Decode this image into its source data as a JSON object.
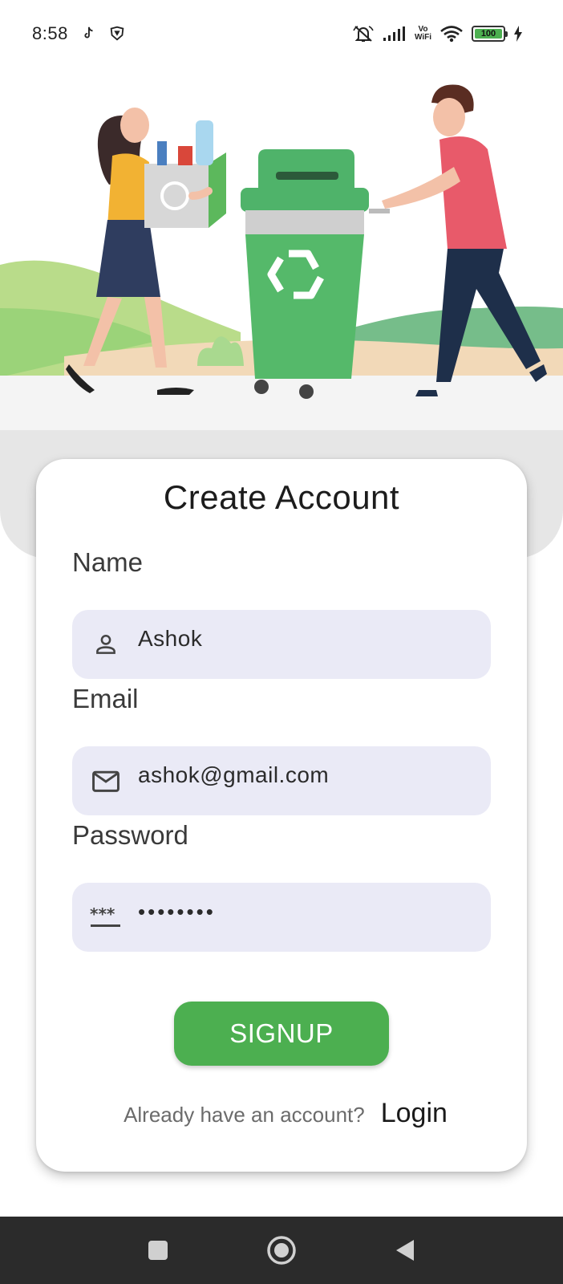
{
  "status_bar": {
    "time": "8:58",
    "vowifi_top": "Vo",
    "vowifi_bottom": "WiFi",
    "battery_level": "100",
    "icons": [
      "tiktok-icon",
      "vpn-shield-icon",
      "mute-icon",
      "signal-icon",
      "wifi-icon",
      "battery-icon",
      "charging-icon"
    ]
  },
  "colors": {
    "accent": "#4caf50",
    "field_bg": "#eaeaf6",
    "nav_bg": "#2b2b2b"
  },
  "form": {
    "title": "Create Account",
    "name_label": "Name",
    "name_value": "Ashok",
    "name_icon": "person-icon",
    "email_label": "Email",
    "email_value": "ashok@gmail.com",
    "email_icon": "mail-icon",
    "password_label": "Password",
    "password_value": "••••••••",
    "password_icon": "password-icon",
    "signup_label": "SIGNUP",
    "login_hint": "Already have an account?",
    "login_label": "Login"
  },
  "nav": {
    "icons": [
      "recent-apps-icon",
      "home-icon",
      "back-icon"
    ]
  }
}
